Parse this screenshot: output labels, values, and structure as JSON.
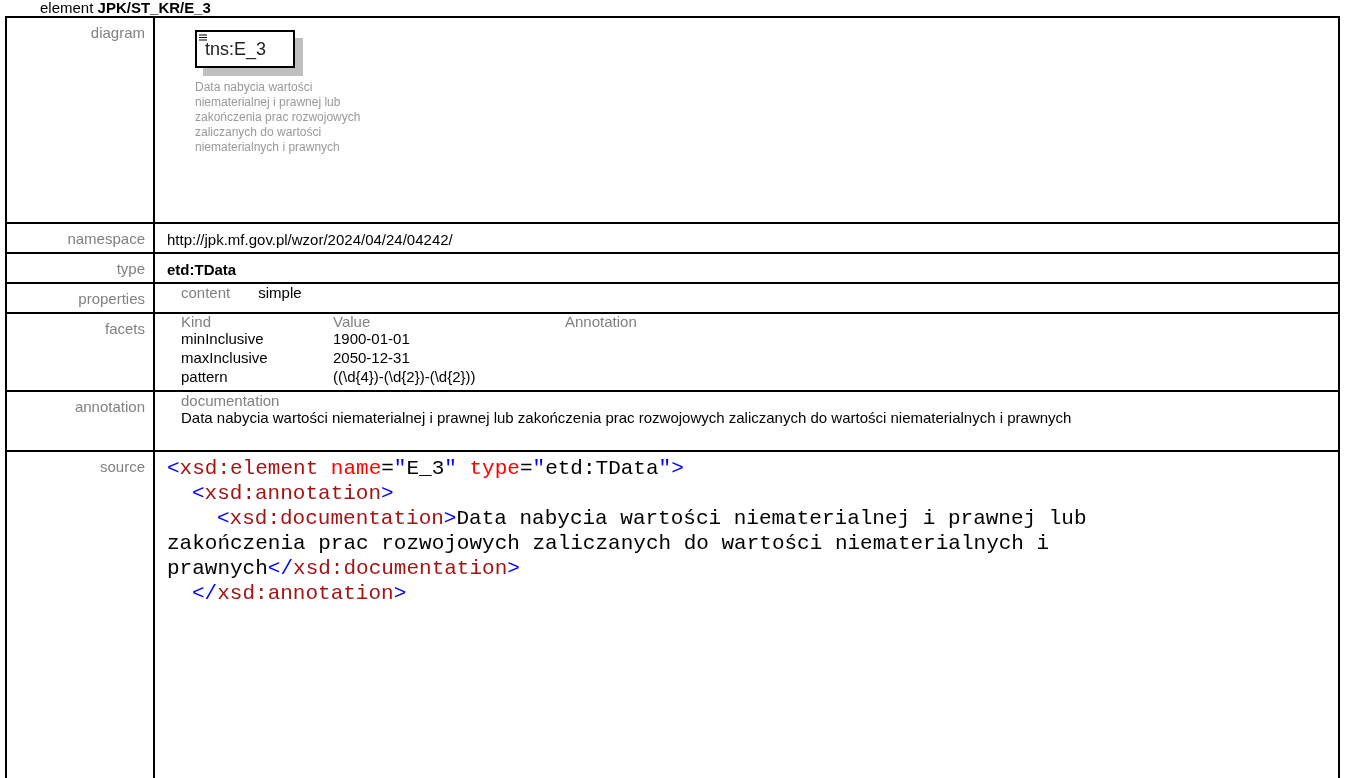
{
  "heading": "element **JPK/ST_KR/E_3**",
  "diagram": {
    "label": "diagram",
    "node": "tns:E_3",
    "description": "Data nabycia wartości niematerialnej i prawnej lub zakończenia prac rozwojowych zaliczanych do wartości niematerialnych i prawnych"
  },
  "namespace": {
    "label": "namespace",
    "value": "http://jpk.mf.gov.pl/wzor/2024/04/24/04242/"
  },
  "type": {
    "label": "type",
    "value": "etd:TData"
  },
  "properties": {
    "label": "properties",
    "items": [
      {
        "name": "content",
        "value": "simple"
      }
    ]
  },
  "facets": {
    "label": "facets",
    "columns": [
      "Kind",
      "Value",
      "Annotation"
    ],
    "rows": [
      {
        "kind": "minInclusive",
        "value": "1900-01-01"
      },
      {
        "kind": "maxInclusive",
        "value": "2050-12-31"
      },
      {
        "kind": "pattern",
        "value": "((\\d{4})-(\\d{2})-(\\d{2}))"
      }
    ]
  },
  "annotation": {
    "label": "annotation",
    "heading": "documentation",
    "text": "Data nabycia wartości niematerialnej i prawnej lub zakończenia prac rozwojowych zaliczanych do wartości niematerialnych i prawnych"
  },
  "source": {
    "label": "source",
    "lines": [
      {
        "kind": "root",
        "tokens": [
          {
            "kind": "bracket",
            "text": "<"
          },
          {
            "kind": "tag",
            "text": "xsd:element"
          },
          {
            "kind": "attr",
            "text": " name"
          },
          {
            "kind": "text",
            "text": "="
          },
          {
            "kind": "bracket",
            "text": "\""
          },
          {
            "kind": "text",
            "text": "E_3"
          },
          {
            "kind": "bracket",
            "text": "\""
          },
          {
            "kind": "attr",
            "text": " type"
          },
          {
            "kind": "text",
            "text": "="
          },
          {
            "kind": "bracket",
            "text": "\""
          },
          {
            "kind": "text",
            "text": "etd:TData"
          },
          {
            "kind": "bracket",
            "text": "\""
          },
          {
            "kind": "bracket",
            "text": ">"
          }
        ]
      },
      {
        "kind": "child",
        "tokens": [
          {
            "kind": "bracket",
            "text": "<"
          },
          {
            "kind": "tag",
            "text": "xsd:annotation"
          },
          {
            "kind": "bracket",
            "text": ">"
          }
        ]
      },
      {
        "kind": "grandchild",
        "tokens": [
          {
            "kind": "bracket",
            "text": "<"
          },
          {
            "kind": "tag",
            "text": "xsd:documentation"
          },
          {
            "kind": "bracket",
            "text": ">"
          },
          {
            "kind": "text",
            "text": "Data nabycia wartości niematerialnej i prawnej lub"
          }
        ]
      },
      {
        "kind": "root",
        "tokens": [
          {
            "kind": "text",
            "text": "zakończenia prac rozwojowych zaliczanych do wartości niematerialnych i"
          }
        ]
      },
      {
        "kind": "root",
        "tokens": [
          {
            "kind": "text",
            "text": "prawnych"
          },
          {
            "kind": "bracket",
            "text": "</"
          },
          {
            "kind": "tag",
            "text": "xsd:documentation"
          },
          {
            "kind": "bracket",
            "text": ">"
          }
        ]
      },
      {
        "kind": "child",
        "tokens": [
          {
            "kind": "bracket",
            "text": "</"
          },
          {
            "kind": "tag",
            "text": "xsd:annotation"
          },
          {
            "kind": "bracket",
            "text": ">"
          }
        ]
      }
    ]
  }
}
